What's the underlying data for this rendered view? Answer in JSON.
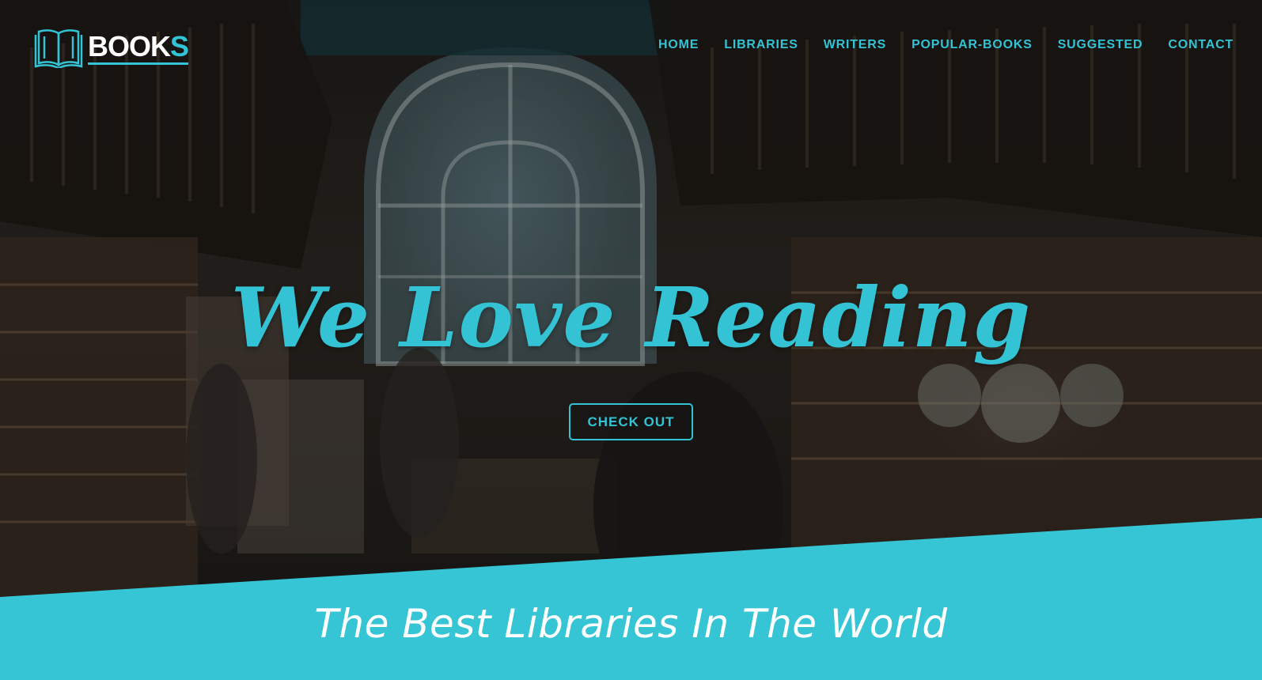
{
  "brand": {
    "logo_text_main": "BOOK",
    "logo_text_accent": "S",
    "logo_icon": "open-book-icon"
  },
  "nav": {
    "items": [
      {
        "label": "HOME"
      },
      {
        "label": "LIBRARIES"
      },
      {
        "label": "WRITERS"
      },
      {
        "label": "POPULAR-BOOKS"
      },
      {
        "label": "SUGGESTED"
      },
      {
        "label": "CONTACT"
      }
    ]
  },
  "hero": {
    "headline": "We Love Reading",
    "cta_label": "CHECK OUT",
    "background": "library-interior-photo"
  },
  "section": {
    "title": "The Best Libraries In The World"
  },
  "colors": {
    "accent": "#33c3d4",
    "band": "#35c5d5",
    "white": "#ffffff"
  }
}
